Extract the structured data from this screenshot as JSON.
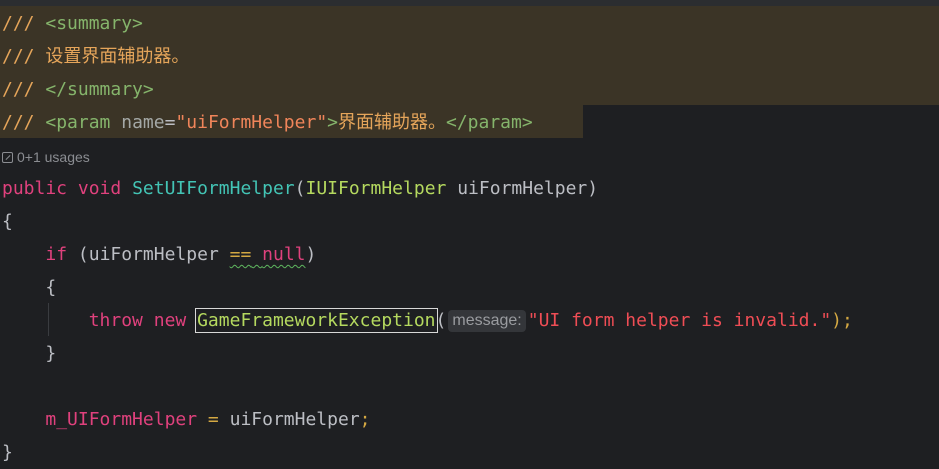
{
  "doc": {
    "line1": {
      "prefix": "/// ",
      "tag": "<summary>"
    },
    "line2": {
      "prefix": "/// ",
      "text": "设置界面辅助器。"
    },
    "line3": {
      "prefix": "/// ",
      "tag": "</summary>"
    },
    "line4": {
      "prefix": "/// ",
      "open": "<param",
      "attr": "name",
      "eq": "=",
      "value": "\"uiFormHelper\"",
      "close": ">",
      "text": "界面辅助器。",
      "end_tag": "</param>"
    }
  },
  "usages": {
    "icon": "external-arrow-icon",
    "label": "0+1 usages"
  },
  "code": {
    "signature": {
      "kw_public": "public",
      "kw_void": "void",
      "method": "SetUIFormHelper",
      "paren_open": "(",
      "param_type": "IUIFormHelper",
      "param_name": "uiFormHelper",
      "paren_close": ")"
    },
    "brace_open": "{",
    "if_line": {
      "kw_if": "if",
      "paren_open": "(",
      "var": "uiFormHelper",
      "op": "==",
      "kw_null": "null",
      "paren_close": ")"
    },
    "inner_brace_open": "{",
    "throw_line": {
      "kw_throw": "throw",
      "kw_new": "new",
      "type": "GameFrameworkException",
      "paren_open": "(",
      "hint": "message:",
      "string": "\"UI form helper is invalid.\"",
      "end": ");"
    },
    "inner_brace_close": "}",
    "assign_line": {
      "field": "m_UIFormHelper",
      "op": "=",
      "value": "uiFormHelper",
      "semi": ";"
    },
    "brace_close": "}"
  },
  "colors": {
    "background": "#1e1f22",
    "doc_highlight": "#3b3426",
    "keyword": "#e0417d",
    "method": "#43c4b5",
    "type": "#b5d95f",
    "string": "#ef4d55"
  }
}
